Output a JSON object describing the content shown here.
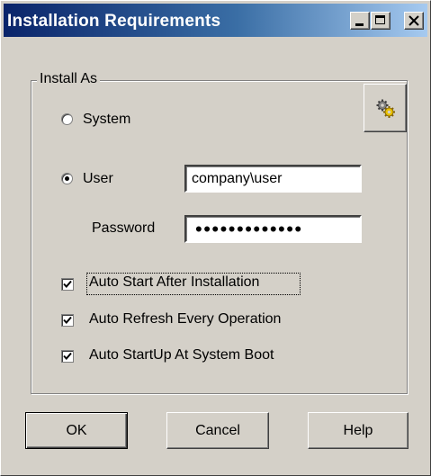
{
  "window": {
    "title": "Installation Requirements"
  },
  "install_as": {
    "group_label": "Install As",
    "gear_icon": "gear-icon",
    "system_label": "System",
    "system_selected": false,
    "user_label": "User",
    "user_selected": true,
    "user_value": "company\\user",
    "password_label": "Password",
    "password_value": "•••••••••••••"
  },
  "options": [
    {
      "label": "Auto Start After Installation",
      "checked": true
    },
    {
      "label": "Auto Refresh Every Operation",
      "checked": true
    },
    {
      "label": "Auto StartUp At System Boot",
      "checked": true
    }
  ],
  "buttons": {
    "ok": "OK",
    "cancel": "Cancel",
    "help": "Help"
  },
  "colors": {
    "title_gradient_start": "#0a246a",
    "title_gradient_end": "#a6caf0",
    "face": "#d4d0c8"
  }
}
